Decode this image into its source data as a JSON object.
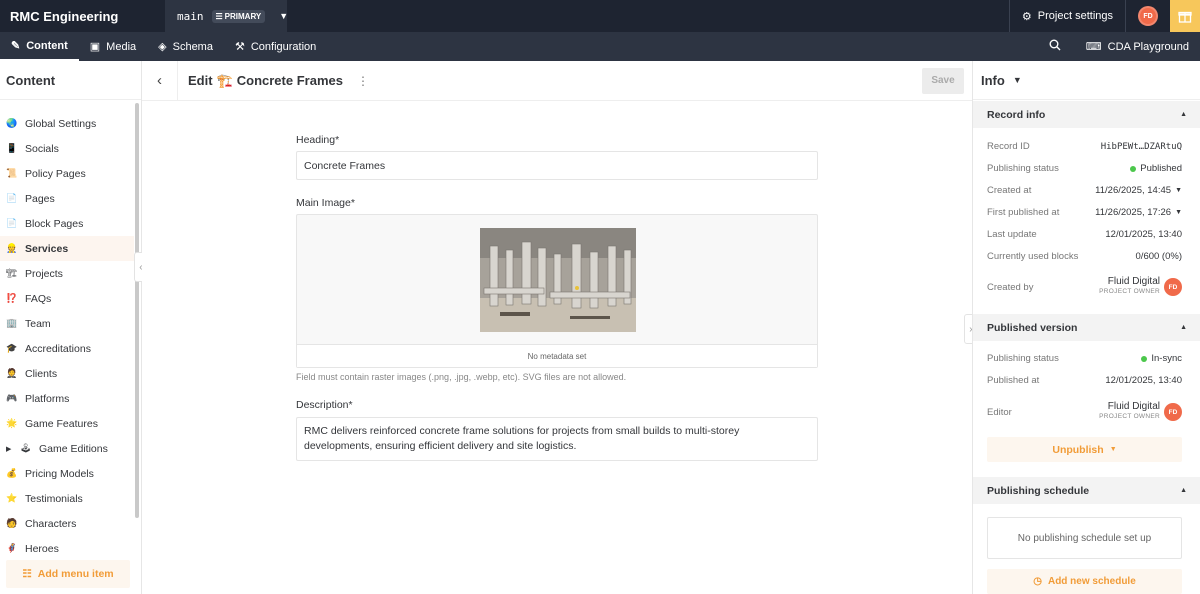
{
  "topbar": {
    "brand": "RMC Engineering",
    "environment": "main",
    "environment_badge": "PRIMARY",
    "project_settings": "Project settings",
    "user_initials": "FD"
  },
  "nav": {
    "content": "Content",
    "media": "Media",
    "schema": "Schema",
    "configuration": "Configuration",
    "cda_playground": "CDA Playground"
  },
  "sidebar": {
    "title": "Content",
    "items": [
      {
        "label": "Global Settings",
        "icon": "🌏"
      },
      {
        "label": "Socials",
        "icon": "📱"
      },
      {
        "label": "Policy Pages",
        "icon": "📜"
      },
      {
        "label": "Pages",
        "icon": "📄"
      },
      {
        "label": "Block Pages",
        "icon": "📄"
      },
      {
        "label": "Services",
        "icon": "👷"
      },
      {
        "label": "Projects",
        "icon": "🏗"
      },
      {
        "label": "FAQs",
        "icon": "⁉️"
      },
      {
        "label": "Team",
        "icon": "🏢"
      },
      {
        "label": "Accreditations",
        "icon": "🎓"
      },
      {
        "label": "Clients",
        "icon": "🤵"
      },
      {
        "label": "Platforms",
        "icon": "🎮"
      },
      {
        "label": "Game Features",
        "icon": "🌟"
      },
      {
        "label": "Game Editions",
        "icon": "🕹"
      },
      {
        "label": "Pricing Models",
        "icon": "💰"
      },
      {
        "label": "Testimonials",
        "icon": "⭐"
      },
      {
        "label": "Characters",
        "icon": "🧑"
      },
      {
        "label": "Heroes",
        "icon": "🦸"
      }
    ],
    "add_menu_item": "Add menu item"
  },
  "editor": {
    "title": "Edit",
    "record_emoji": "🏗️",
    "record_name": "Concrete Frames",
    "save": "Save",
    "heading_label": "Heading*",
    "heading_value": "Concrete Frames",
    "main_image_label": "Main Image*",
    "no_metadata": "No metadata set",
    "image_hint": "Field must contain raster images (.png, .jpg, .webp, etc). SVG files are not allowed.",
    "description_label": "Description*",
    "description_value": "RMC delivers reinforced concrete frame solutions for projects from small builds to multi-storey developments, ensuring efficient delivery and site logistics."
  },
  "info": {
    "title": "Info",
    "record_info": {
      "title": "Record info",
      "record_id_label": "Record ID",
      "record_id": "HibPEWt…DZARtuQ",
      "publishing_status_label": "Publishing status",
      "publishing_status": "Published",
      "created_at_label": "Created at",
      "created_at": "11/26/2025, 14:45",
      "first_published_label": "First published at",
      "first_published": "11/26/2025, 17:26",
      "last_update_label": "Last update",
      "last_update": "12/01/2025, 13:40",
      "blocks_label": "Currently used blocks",
      "blocks": "0/600 (0%)",
      "created_by_label": "Created by",
      "created_by": "Fluid Digital",
      "created_by_role": "PROJECT OWNER"
    },
    "published_version": {
      "title": "Published version",
      "status_label": "Publishing status",
      "status": "In-sync",
      "published_at_label": "Published at",
      "published_at": "12/01/2025, 13:40",
      "editor_label": "Editor",
      "editor": "Fluid Digital",
      "editor_role": "PROJECT OWNER",
      "unpublish": "Unpublish"
    },
    "schedule": {
      "title": "Publishing schedule",
      "empty": "No publishing schedule set up",
      "add": "Add new schedule"
    }
  },
  "colors": {
    "topbar": "#1e2431",
    "navbar": "#2d3442",
    "accent": "#f19c38",
    "published_dot": "#4cc74c",
    "avatar": "#f06a4a"
  }
}
